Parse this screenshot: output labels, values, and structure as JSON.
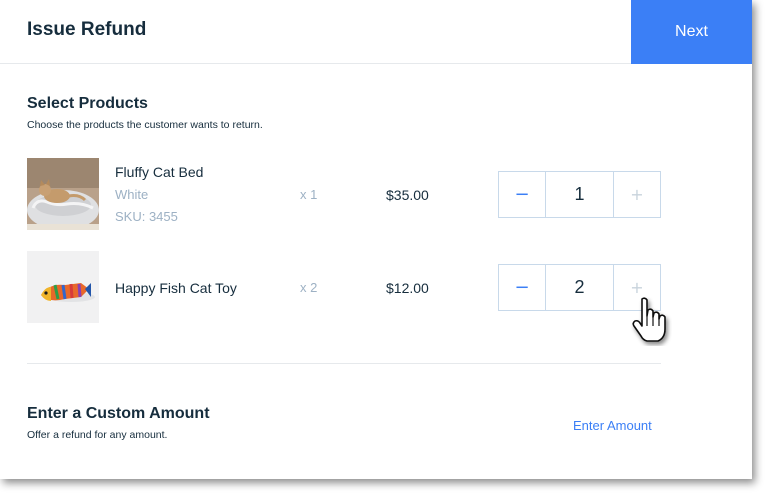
{
  "header": {
    "title": "Issue Refund",
    "next_label": "Next"
  },
  "select_products": {
    "title": "Select Products",
    "subtitle": "Choose the products the customer wants to return."
  },
  "products": [
    {
      "name": "Fluffy Cat Bed",
      "variant": "White",
      "sku": "SKU: 3455",
      "qty_label": "x 1",
      "price": "$35.00",
      "refund_qty": "1",
      "minus_icon": "minus-icon",
      "plus_icon": "plus-icon"
    },
    {
      "name": "Happy Fish Cat Toy",
      "qty_label": "x 2",
      "price": "$12.00",
      "refund_qty": "2",
      "minus_icon": "minus-icon",
      "plus_icon": "plus-icon"
    }
  ],
  "custom_amount": {
    "title": "Enter a Custom Amount",
    "subtitle": "Offer a refund for any amount.",
    "link_label": "Enter Amount"
  },
  "colors": {
    "accent": "#3b7ff6",
    "text": "#162d3d",
    "muted": "#9db1c4",
    "border": "#c8d9ea"
  }
}
